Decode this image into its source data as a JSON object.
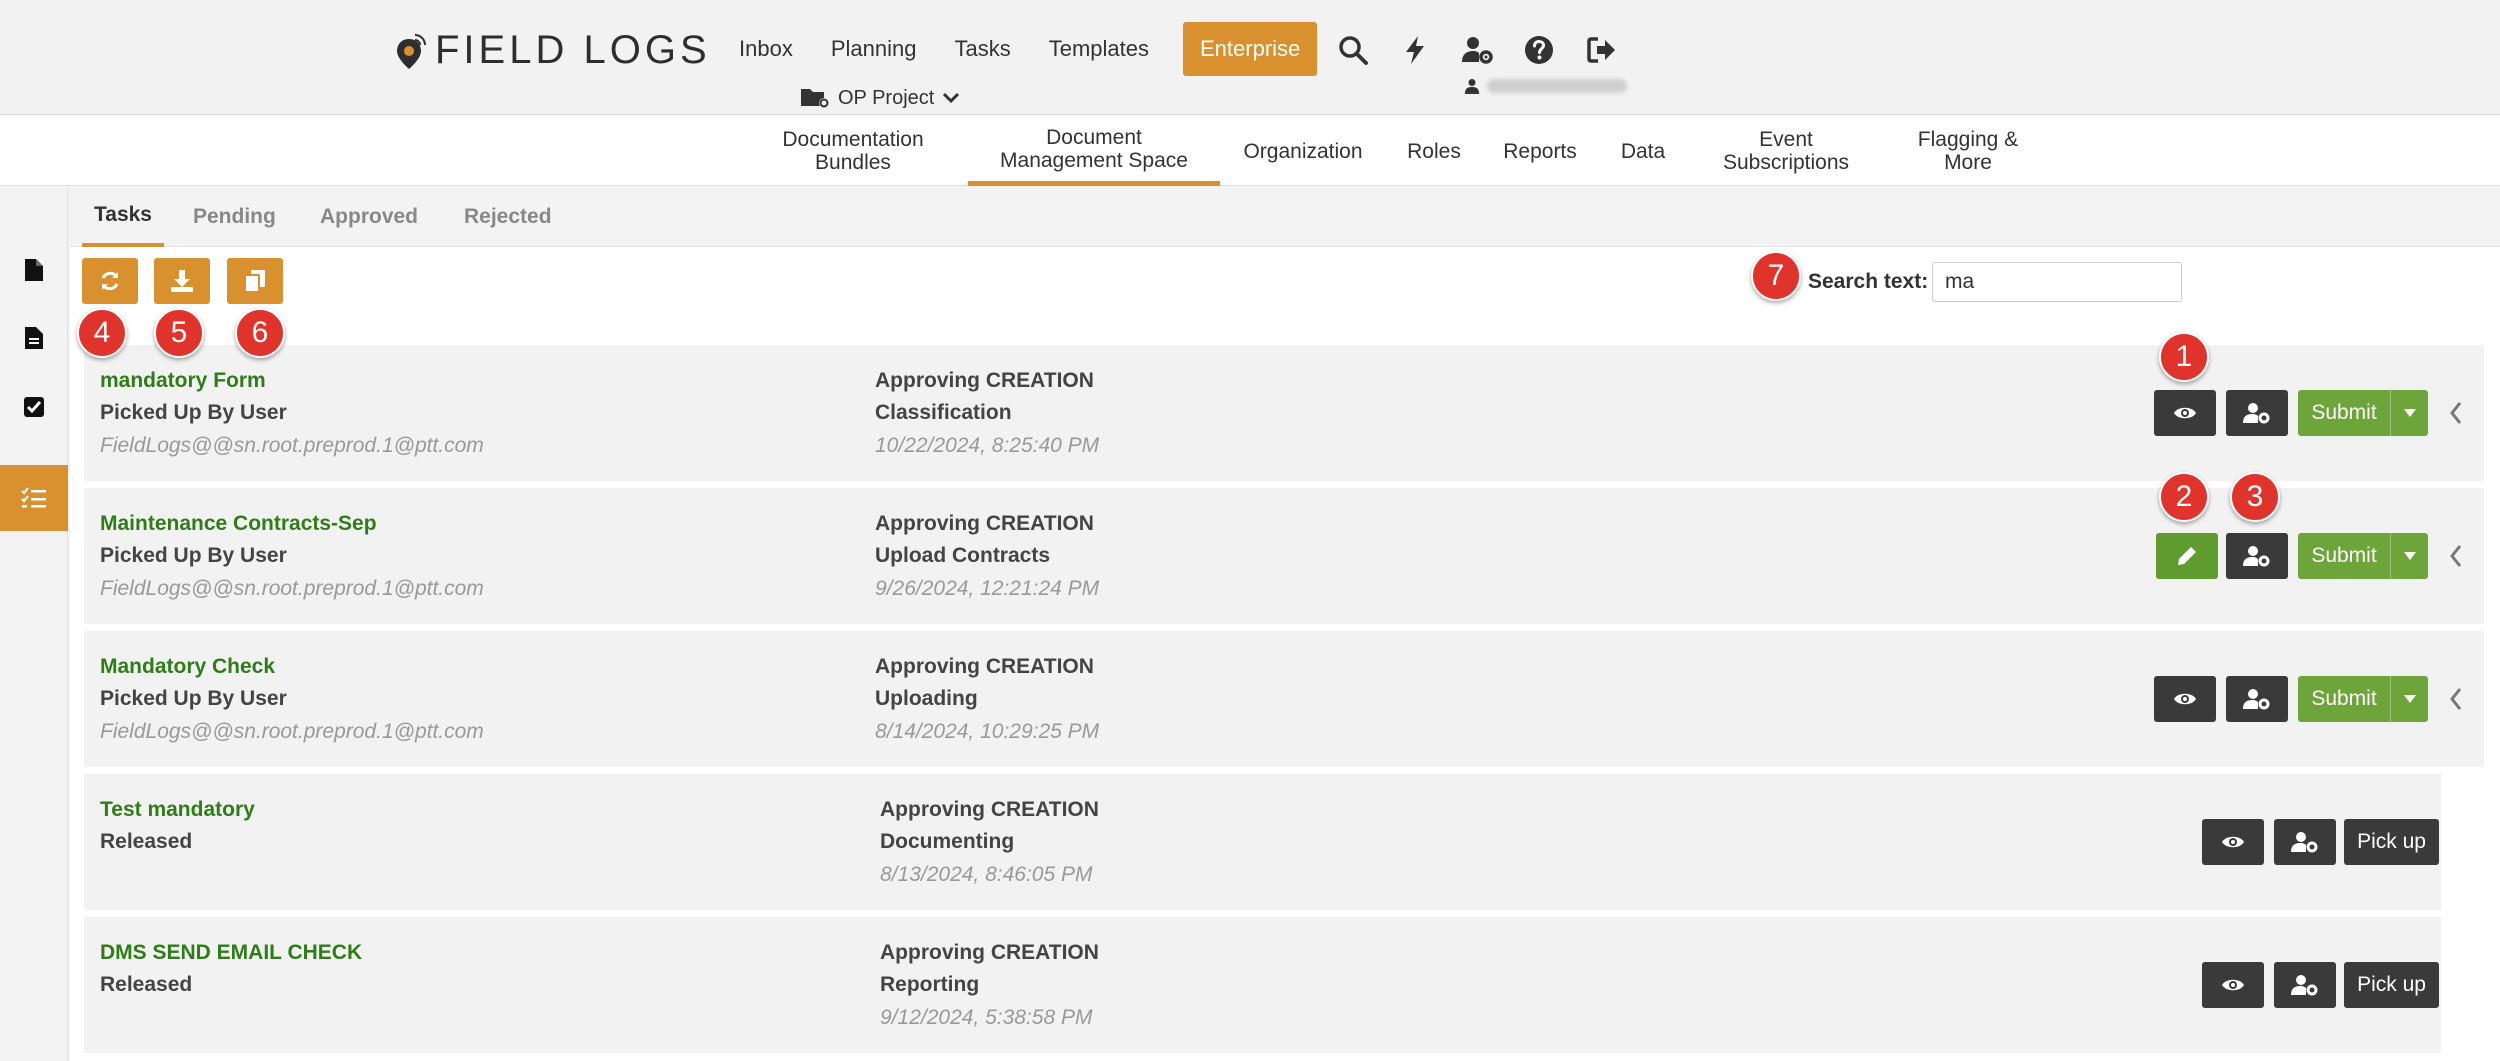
{
  "header": {
    "logo_text": "FIELD LOGS",
    "nav": [
      "Inbox",
      "Planning",
      "Tasks",
      "Templates"
    ],
    "enterprise_label": "Enterprise",
    "project_label": "OP Project",
    "icons": [
      "search-icon",
      "bolt-icon",
      "user-settings-icon",
      "help-icon",
      "sign-out-icon"
    ]
  },
  "subnav": {
    "items": [
      {
        "line1": "Documentation",
        "line2": "Bundles"
      },
      {
        "line1": "Document",
        "line2": "Management Space"
      },
      {
        "line1": "Organization",
        "line2": ""
      },
      {
        "line1": "Roles",
        "line2": ""
      },
      {
        "line1": "Reports",
        "line2": ""
      },
      {
        "line1": "Data",
        "line2": ""
      },
      {
        "line1": "Event",
        "line2": "Subscriptions"
      },
      {
        "line1": "Flagging &",
        "line2": "More"
      }
    ],
    "active_index": 1
  },
  "rail": {
    "icons": [
      "file-icon",
      "document-icon",
      "checkbox-icon",
      "task-list-icon"
    ],
    "active_index": 3
  },
  "tabs": {
    "items": [
      "Tasks",
      "Pending",
      "Approved",
      "Rejected"
    ],
    "active_index": 0
  },
  "toolbar": {
    "icons": [
      "refresh-icon",
      "download-icon",
      "copy-icon"
    ]
  },
  "search": {
    "label": "Search text:",
    "value": "ma"
  },
  "markers": [
    "1",
    "2",
    "3",
    "4",
    "5",
    "6",
    "7"
  ],
  "tasks": [
    {
      "name": "mandatory Form",
      "status": "Picked Up By User",
      "user": "FieldLogs@@sn.root.preprod.1@ptt.com",
      "approving": "Approving CREATION",
      "stage": "Classification",
      "date": "10/22/2024, 8:25:40 PM",
      "action": "Submit"
    },
    {
      "name": "Maintenance Contracts-Sep",
      "status": "Picked Up By User",
      "user": "FieldLogs@@sn.root.preprod.1@ptt.com",
      "approving": "Approving CREATION",
      "stage": "Upload Contracts",
      "date": "9/26/2024, 12:21:24 PM",
      "action": "Submit"
    },
    {
      "name": "Mandatory Check",
      "status": "Picked Up By User",
      "user": "FieldLogs@@sn.root.preprod.1@ptt.com",
      "approving": "Approving CREATION",
      "stage": "Uploading",
      "date": "8/14/2024, 10:29:25 PM",
      "action": "Submit"
    },
    {
      "name": "Test mandatory",
      "status": "Released",
      "user": "",
      "approving": "Approving CREATION",
      "stage": "Documenting",
      "date": "8/13/2024, 8:46:05 PM",
      "action": "Pick up"
    },
    {
      "name": "DMS SEND EMAIL CHECK",
      "status": "Released",
      "user": "",
      "approving": "Approving CREATION",
      "stage": "Reporting",
      "date": "9/12/2024, 5:38:58 PM",
      "action": "Pick up"
    }
  ],
  "colors": {
    "accent": "#d9912f",
    "link_green": "#2f7d18",
    "submit_green": "#6ea53a",
    "marker_red": "#e0332c",
    "dark_button": "#3a3a3a"
  }
}
